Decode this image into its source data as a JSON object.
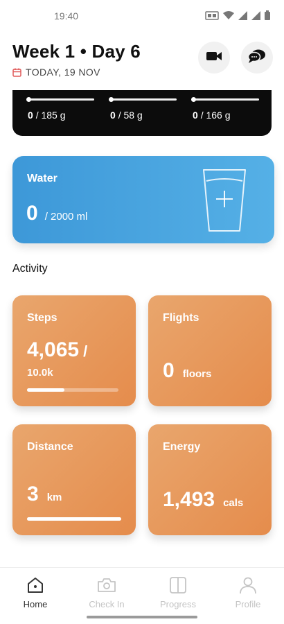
{
  "status_bar": {
    "time": "19:40"
  },
  "header": {
    "title": "Week 1 • Day 6",
    "date": "TODAY, 19 NOV"
  },
  "food_summary": {
    "macros": [
      {
        "current": "0",
        "target": "/ 185 g"
      },
      {
        "current": "0",
        "target": "/ 58 g"
      },
      {
        "current": "0",
        "target": "/ 166 g"
      }
    ]
  },
  "water": {
    "title": "Water",
    "value": "0",
    "target": "/ 2000 ml"
  },
  "activity": {
    "section_title": "Activity",
    "steps": {
      "title": "Steps",
      "value": "4,065",
      "slash": "/",
      "goal": "10.0k",
      "progress": 0.41
    },
    "flights": {
      "title": "Flights",
      "value": "0",
      "unit": "floors"
    },
    "distance": {
      "title": "Distance",
      "value": "3",
      "unit": "km",
      "progress": 1.0
    },
    "energy": {
      "title": "Energy",
      "value": "1,493",
      "unit": "cals"
    }
  },
  "bottom_nav": {
    "items": [
      {
        "label": "Home",
        "icon": "home-icon",
        "active": true
      },
      {
        "label": "Check In",
        "icon": "camera-icon",
        "active": false
      },
      {
        "label": "Progress",
        "icon": "compare-icon",
        "active": false
      },
      {
        "label": "Profile",
        "icon": "person-icon",
        "active": false
      }
    ]
  },
  "colors": {
    "water_card": "#3d98d8",
    "activity_tile": "#e58c4c",
    "calendar_icon": "#e05a5a"
  }
}
